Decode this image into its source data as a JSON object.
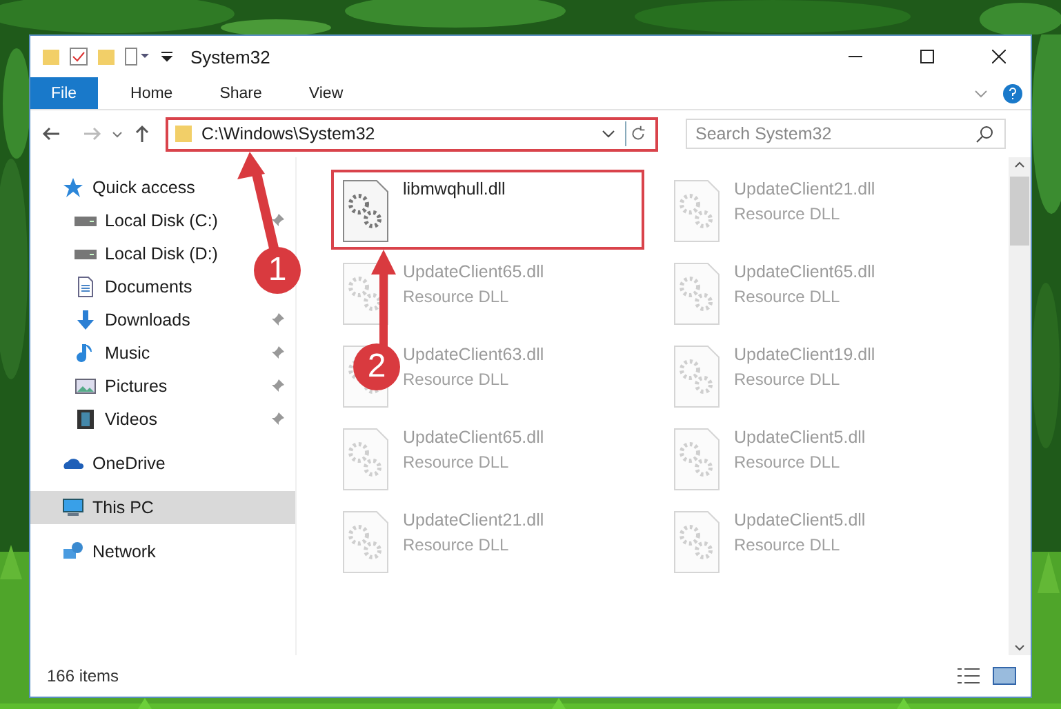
{
  "window": {
    "title": "System32"
  },
  "ribbon_tabs": [
    {
      "label": "File",
      "selected": true
    },
    {
      "label": "Home",
      "selected": false
    },
    {
      "label": "Share",
      "selected": false
    },
    {
      "label": "View",
      "selected": false
    }
  ],
  "address_bar": {
    "path": "C:\\Windows\\System32",
    "highlighted": true
  },
  "search": {
    "placeholder": "Search System32"
  },
  "sidebar": {
    "items": [
      {
        "label": "Quick access",
        "kind": "star",
        "selected": false,
        "children": [
          {
            "label": "Local Disk (C:)",
            "kind": "disk",
            "pinned": true
          },
          {
            "label": "Local Disk (D:)",
            "kind": "disk",
            "pinned": false
          },
          {
            "label": "Documents",
            "kind": "doc",
            "pinned": false
          },
          {
            "label": "Downloads",
            "kind": "download",
            "pinned": true
          },
          {
            "label": "Music",
            "kind": "music",
            "pinned": true
          },
          {
            "label": "Pictures",
            "kind": "pictures",
            "pinned": true
          },
          {
            "label": "Videos",
            "kind": "videos",
            "pinned": true
          }
        ]
      },
      {
        "label": "OneDrive",
        "kind": "cloud",
        "selected": false
      },
      {
        "label": "This PC",
        "kind": "pc",
        "selected": true
      },
      {
        "label": "Network",
        "kind": "network",
        "selected": false
      }
    ]
  },
  "files": [
    {
      "name": "libmwqhull.dll",
      "faded": false,
      "highlighted": true
    },
    {
      "name": "UpdateClient21.dll",
      "type": "Resource DLL",
      "faded": true,
      "highlighted": false
    },
    {
      "name": "UpdateClient65.dll",
      "type": "Resource DLL",
      "faded": true,
      "highlighted": false
    },
    {
      "name": "UpdateClient65.dll",
      "type": "Resource DLL",
      "faded": true,
      "highlighted": false
    },
    {
      "name": "UpdateClient63.dll",
      "type": "Resource DLL",
      "faded": true,
      "highlighted": false
    },
    {
      "name": "UpdateClient19.dll",
      "type": "Resource DLL",
      "faded": true,
      "highlighted": false
    },
    {
      "name": "UpdateClient65.dll",
      "type": "Resource DLL",
      "faded": true,
      "highlighted": false
    },
    {
      "name": "UpdateClient5.dll",
      "type": "Resource DLL",
      "faded": true,
      "highlighted": false
    },
    {
      "name": "UpdateClient21.dll",
      "type": "Resource DLL",
      "faded": true,
      "highlighted": false
    },
    {
      "name": "UpdateClient5.dll",
      "type": "Resource DLL",
      "faded": true,
      "highlighted": false
    }
  ],
  "annotations": [
    {
      "label": "1"
    },
    {
      "label": "2"
    }
  ],
  "status_bar": {
    "count": "166 items"
  }
}
